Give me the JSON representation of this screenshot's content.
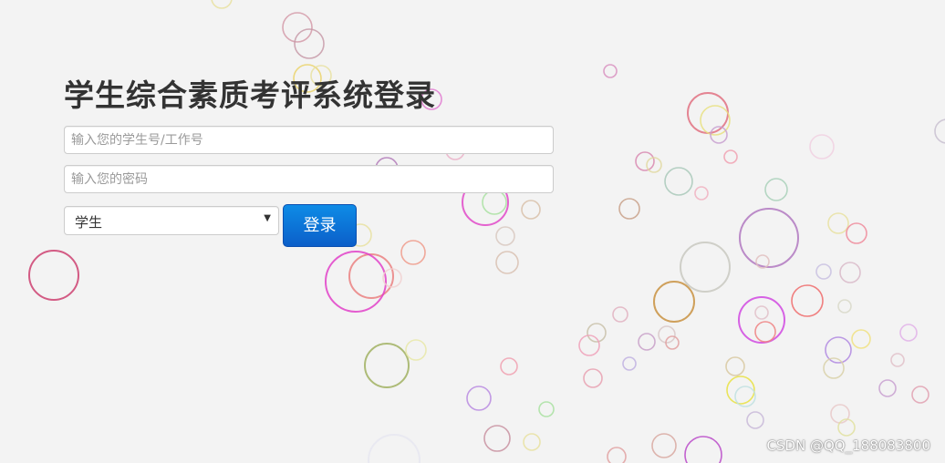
{
  "login": {
    "title": "学生综合素质考评系统登录",
    "username_placeholder": "输入您的学生号/工作号",
    "password_placeholder": "输入您的密码",
    "role_selected": "学生",
    "login_button": "登录"
  },
  "watermark": "CSDN @QQ_188083800",
  "colors": {
    "background": "#f3f3f3",
    "title": "#333333",
    "button": "#0b6fd6"
  }
}
